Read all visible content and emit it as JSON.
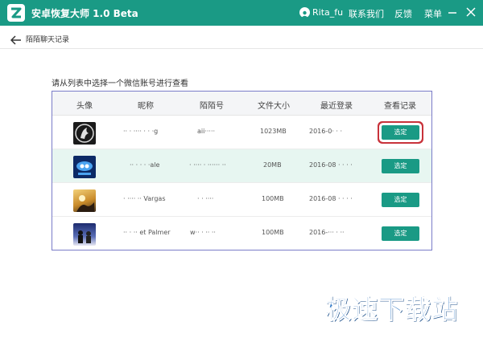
{
  "window": {
    "title": "安卓恢复大师 1.0 Beta",
    "user_name": "Rita_fu",
    "links": {
      "contact": "联系我们",
      "feedback": "反馈",
      "menu": "菜单"
    },
    "accent_color": "#1a9a85"
  },
  "nav": {
    "breadcrumb": "陌陌聊天记录"
  },
  "main": {
    "instruction": "请从列表中选择一个微信账号进行查看",
    "table": {
      "headers": [
        "头像",
        "昵称",
        "陌陌号",
        "文件大小",
        "最近登录",
        "查看记录"
      ],
      "rows": [
        {
          "nickname": "‧‧ ‧ ‧‧‧‧ ‧ ‧ ‧g",
          "momo_id": "aii‧‧‧‧‧",
          "size": "1023MB",
          "last_login": "2016-0‧ ‧ ‧",
          "button": "选定",
          "avatar": "dark-animal"
        },
        {
          "nickname": "‧‧ ‧ ‧ ‧ ‧ale",
          "momo_id": "‧ ‧‧‧‧ ‧ ‧‧‧‧‧‧ ‧‧",
          "size": "20MB",
          "last_login": "2016-08 ‧ ‧ ‧ ‧",
          "button": "选定",
          "avatar": "blue-badge"
        },
        {
          "nickname": "‧ ‧‧‧‧ ‧‧ Vargas",
          "momo_id": "‧ ‧ ‧‧‧‧",
          "size": "100MB",
          "last_login": "2016-08 ‧ ‧ ‧ ‧",
          "button": "选定",
          "avatar": "sunset"
        },
        {
          "nickname": "‧‧ ‧ ‧‧ et Palmer",
          "momo_id": "w‧‧ ‧ ‧‧ ‧‧",
          "size": "100MB",
          "last_login": "2016-‧‧‧ ‧ ‧‧",
          "button": "选定",
          "avatar": "night-figures"
        }
      ]
    }
  },
  "watermark": "极速下载站"
}
